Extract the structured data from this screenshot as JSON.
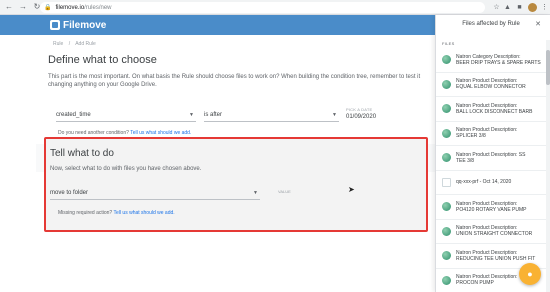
{
  "browser": {
    "url_host": "filemove.io",
    "url_path": "/rules/new"
  },
  "app": {
    "logo": "Filemove"
  },
  "breadcrumb": [
    "Rule",
    "Add Rule"
  ],
  "define": {
    "title": "Define what to choose",
    "description": "This part is the most important. On what basis the Rule should choose files to work on? When building the condition tree, remember to test it changing anything on your Google Drive.",
    "field": "created_time",
    "operator": "is after",
    "date_label": "PICK A DATE",
    "date_value": "01/09/2020",
    "hint_text": "Do you need another condition?",
    "hint_link": "Tell us what should we add."
  },
  "tell": {
    "title": "Tell what to do",
    "description": "Now, select what to do with files you have chosen above.",
    "action": "move to folder",
    "value_label": "VALUE",
    "hint_text": "Missing required action?",
    "hint_link": "Tell us what should we add."
  },
  "panel": {
    "title": "Files affected by Rule",
    "section": "FILES",
    "files": [
      {
        "line1": "Natron Category Description:",
        "line2": "BEER DRIP TRAYS & SPARE PARTS",
        "icon": "sheet"
      },
      {
        "line1": "Natron Product Description:",
        "line2": "EQUAL ELBOW CONNECTOR",
        "icon": "sheet"
      },
      {
        "line1": "Natron Product Description:",
        "line2": "BALL LOCK DISCONNECT BARB",
        "icon": "sheet"
      },
      {
        "line1": "Natron Product Description:",
        "line2": "SPLICER 3/8",
        "icon": "sheet"
      },
      {
        "line1": "Natron Product Description: SS",
        "line2": "TEE 3/8",
        "icon": "sheet"
      },
      {
        "line1": "qq-xxx-prf - Oct 14, 2020",
        "line2": "",
        "icon": "doc"
      },
      {
        "line1": "Natron Product Description:",
        "line2": "PO4120 ROTARY VANE PUMP",
        "icon": "sheet"
      },
      {
        "line1": "Natron Product Description:",
        "line2": "UNION STRAIGHT CONNECTOR",
        "icon": "sheet"
      },
      {
        "line1": "Natron Product Description:",
        "line2": "REDUCING TEE UNION PUSH FIT",
        "icon": "sheet"
      },
      {
        "line1": "Natron Product Description:",
        "line2": "PROCON PUMP",
        "icon": "sheet"
      }
    ]
  }
}
